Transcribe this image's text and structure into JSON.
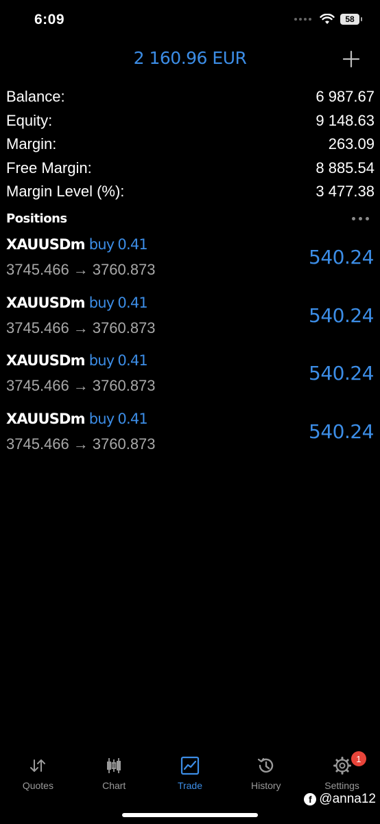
{
  "status_bar": {
    "time": "6:09",
    "battery": "58"
  },
  "header": {
    "balance": "2 160.96 EUR"
  },
  "summary": [
    {
      "label": "Balance:",
      "value": "6 987.67"
    },
    {
      "label": "Equity:",
      "value": "9 148.63"
    },
    {
      "label": "Margin:",
      "value": "263.09"
    },
    {
      "label": "Free Margin:",
      "value": "8 885.54"
    },
    {
      "label": "Margin Level (%):",
      "value": "3 477.38"
    }
  ],
  "positions": {
    "title": "Positions",
    "items": [
      {
        "symbol": "XAUUSDm",
        "side": "buy",
        "volume": "0.41",
        "open_price": "3745.466",
        "arrow": "→",
        "current_price": "3760.873",
        "profit": "540.24"
      },
      {
        "symbol": "XAUUSDm",
        "side": "buy",
        "volume": "0.41",
        "open_price": "3745.466",
        "arrow": "→",
        "current_price": "3760.873",
        "profit": "540.24"
      },
      {
        "symbol": "XAUUSDm",
        "side": "buy",
        "volume": "0.41",
        "open_price": "3745.466",
        "arrow": "→",
        "current_price": "3760.873",
        "profit": "540.24"
      },
      {
        "symbol": "XAUUSDm",
        "side": "buy",
        "volume": "0.41",
        "open_price": "3745.466",
        "arrow": "→",
        "current_price": "3760.873",
        "profit": "540.24"
      }
    ]
  },
  "tabs": [
    {
      "label": "Quotes",
      "icon": "quotes-arrows-icon"
    },
    {
      "label": "Chart",
      "icon": "candlestick-chart-icon"
    },
    {
      "label": "Trade",
      "icon": "trade-chart-icon",
      "active": true
    },
    {
      "label": "History",
      "icon": "history-clock-icon"
    },
    {
      "label": "Settings",
      "icon": "gear-icon",
      "badge": "1"
    }
  ],
  "watermark": {
    "text": "@anna12"
  },
  "colors": {
    "accent": "#3c8de6",
    "background": "#000000",
    "badge": "#e8443a",
    "secondary_text": "#a8a8a8"
  }
}
